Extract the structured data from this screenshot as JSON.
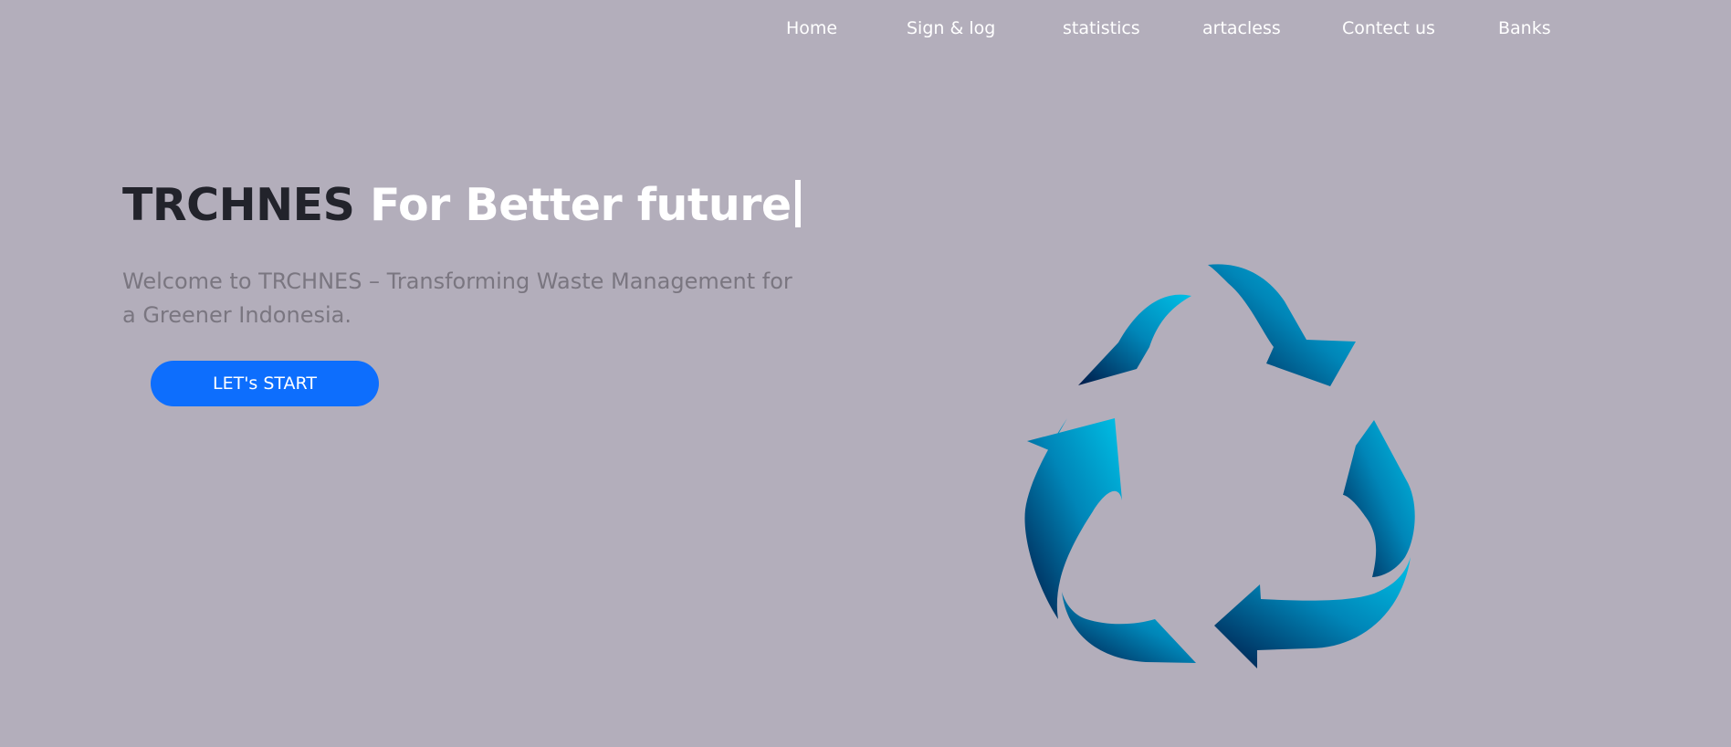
{
  "nav": {
    "items": [
      {
        "label": "Home"
      },
      {
        "label": "Sign & log"
      },
      {
        "label": "statistics"
      },
      {
        "label": "artacless"
      },
      {
        "label": "Contect us"
      },
      {
        "label": "Banks"
      }
    ]
  },
  "hero": {
    "brand": "TRCHNES",
    "tagline": "For Better future",
    "subtitle": "Welcome to TRCHNES – Transforming Waste Management for a Greener Indonesia.",
    "cta_label": "LET's START"
  },
  "icons": {
    "recycle": "recycle-icon"
  },
  "colors": {
    "background": "#b3aebb",
    "cta": "#0d6efd",
    "brand_text": "#22232b",
    "recycle_light": "#00b4dc",
    "recycle_dark": "#001d4a"
  }
}
